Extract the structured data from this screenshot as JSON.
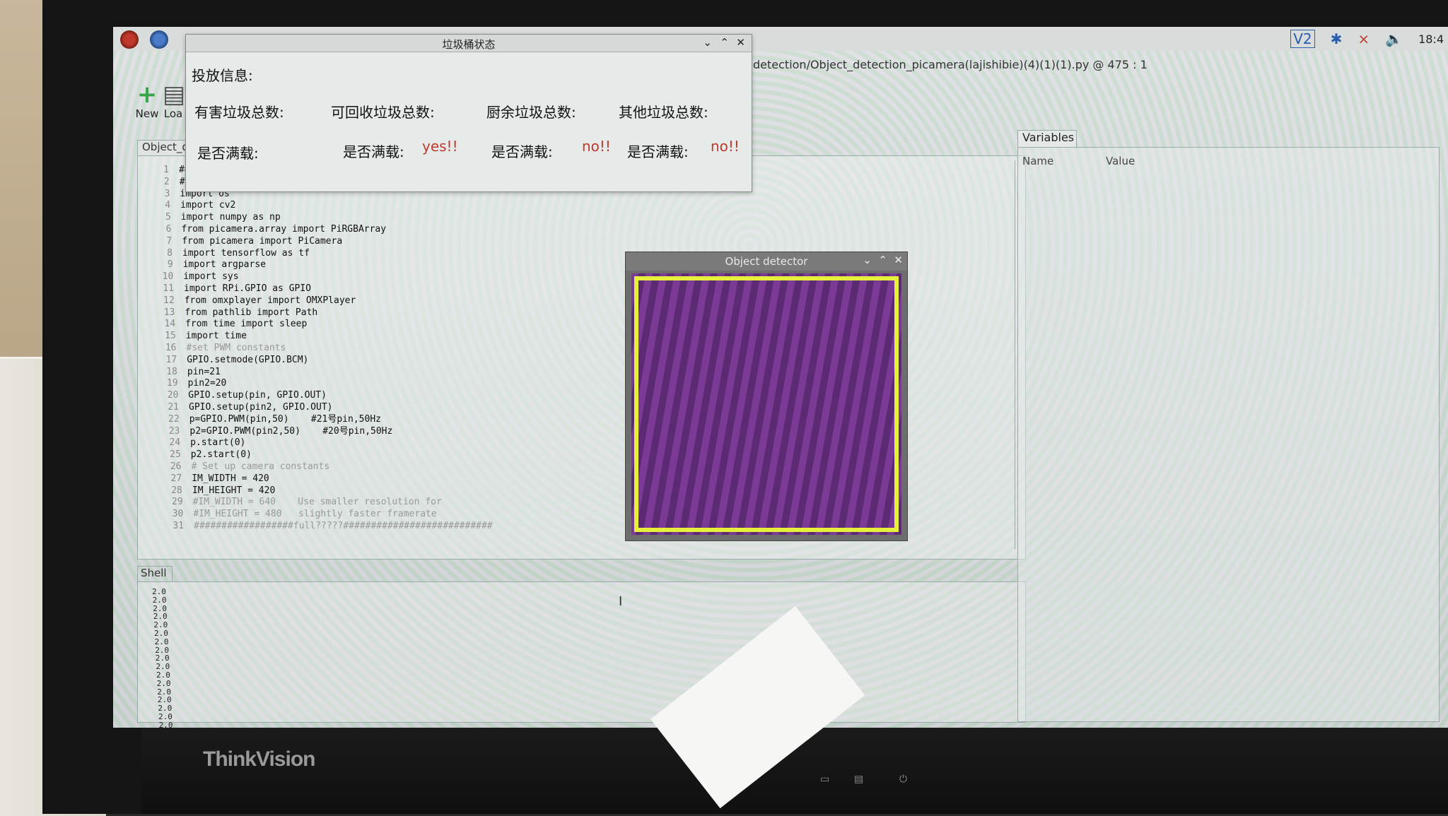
{
  "taskbar": {
    "tray": [
      "V2",
      "✱",
      "⨯",
      "🔈"
    ],
    "clock": "18:4"
  },
  "ide": {
    "title_path": "detection/Object_detection_picamera(lajishibie)(4)(1)(1).py @ 475 : 1",
    "toolbar": {
      "new_label": "New",
      "load_label": "Loa"
    },
    "editor_tab": "Object_dete",
    "code_lines": [
      {
        "n": "1",
        "t": "####"
      },
      {
        "n": "2",
        "t": "# Im"
      },
      {
        "n": "3",
        "t": "import os"
      },
      {
        "n": "4",
        "t": "import cv2"
      },
      {
        "n": "5",
        "t": "import numpy as np"
      },
      {
        "n": "6",
        "t": "from picamera.array import PiRGBArray"
      },
      {
        "n": "7",
        "t": "from picamera import PiCamera"
      },
      {
        "n": "8",
        "t": "import tensorflow as tf"
      },
      {
        "n": "9",
        "t": "import argparse"
      },
      {
        "n": "10",
        "t": "import sys"
      },
      {
        "n": "11",
        "t": "import RPi.GPIO as GPIO"
      },
      {
        "n": "12",
        "t": "from omxplayer import OMXPlayer"
      },
      {
        "n": "13",
        "t": "from pathlib import Path"
      },
      {
        "n": "14",
        "t": "from time import sleep"
      },
      {
        "n": "15",
        "t": "import time"
      },
      {
        "n": "16",
        "t": "#set PWM constants"
      },
      {
        "n": "17",
        "t": "GPIO.setmode(GPIO.BCM)"
      },
      {
        "n": "18",
        "t": "pin=21"
      },
      {
        "n": "19",
        "t": "pin2=20"
      },
      {
        "n": "20",
        "t": "GPIO.setup(pin, GPIO.OUT)"
      },
      {
        "n": "21",
        "t": "GPIO.setup(pin2, GPIO.OUT)"
      },
      {
        "n": "22",
        "t": "p=GPIO.PWM(pin,50)    #21号pin,50Hz"
      },
      {
        "n": "23",
        "t": "p2=GPIO.PWM(pin2,50)    #20号pin,50Hz"
      },
      {
        "n": "24",
        "t": "p.start(0)"
      },
      {
        "n": "25",
        "t": "p2.start(0)"
      },
      {
        "n": "26",
        "t": "# Set up camera constants"
      },
      {
        "n": "27",
        "t": "IM_WIDTH = 420"
      },
      {
        "n": "28",
        "t": "IM_HEIGHT = 420"
      },
      {
        "n": "29",
        "t": "#IM_WIDTH = 640    Use smaller resolution for"
      },
      {
        "n": "30",
        "t": "#IM_HEIGHT = 480   slightly faster framerate"
      },
      {
        "n": "31",
        "t": "##################full?????###########################"
      }
    ],
    "shell_tab": "Shell",
    "shell_lines": [
      "2.0",
      "2.0",
      "2.0",
      "2.0",
      "2.0",
      "2.0",
      "2.0",
      "2.0",
      "2.0",
      "2.0",
      "2.0",
      "2.0",
      "2.0",
      "2.0",
      "2.0",
      "2.0",
      "2.0",
      "2.0"
    ],
    "vars_tab": "Variables",
    "vars_cols": {
      "name": "Name",
      "value": "Value"
    }
  },
  "trash_window": {
    "title": "垃圾桶状态",
    "info_label": "投放信息:",
    "bins": [
      {
        "label": "有害垃圾总数:",
        "full_label": "是否满载:",
        "full_value": ""
      },
      {
        "label": "可回收垃圾总数:",
        "full_label": "是否满载:",
        "full_value": "yes!!"
      },
      {
        "label": "厨余垃圾总数:",
        "full_label": "是否满载:",
        "full_value": "no!!"
      },
      {
        "label": "其他垃圾总数:",
        "full_label": "是否满载:",
        "full_value": "no!!"
      }
    ]
  },
  "detector_window": {
    "title": "Object detector"
  },
  "monitor": {
    "brand": "ThinkVision"
  },
  "colors": {
    "detection_box": "#e6f03a",
    "frame": "#6b3385"
  }
}
